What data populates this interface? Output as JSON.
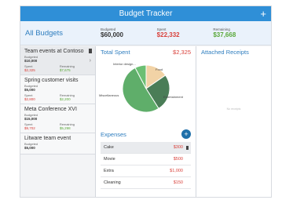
{
  "app": {
    "title": "Budget Tracker",
    "add_symbol": "+"
  },
  "summary": {
    "heading": "All Budgets",
    "budgeted": {
      "label": "Budgeted",
      "value": "$60,000"
    },
    "spent": {
      "label": "Spent",
      "value": "$22,332",
      "color": "#d9413b"
    },
    "remaining": {
      "label": "Remaining",
      "value": "$37,668",
      "color": "#5aa83a"
    }
  },
  "budgets": [
    {
      "name": "Team events at Contoso",
      "budgeted_label": "Budgeted",
      "budgeted": "$10,000",
      "spent_label": "Spent",
      "spent": "$2,325",
      "remaining_label": "Remaining",
      "remaining": "$7,675",
      "selected": true
    },
    {
      "name": "Spring customer visits",
      "budgeted_label": "Budgeted",
      "budgeted": "$5,000",
      "spent_label": "Spent",
      "spent": "$2,800",
      "remaining_label": "Remaining",
      "remaining": "$2,200"
    },
    {
      "name": "Meta Conference XVI",
      "budgeted_label": "Budgeted",
      "budgeted": "$15,000",
      "spent_label": "Spent",
      "spent": "$9,702",
      "remaining_label": "Remaining",
      "remaining": "$5,298"
    },
    {
      "name": "Litware team event",
      "budgeted_label": "Budgeted",
      "budgeted": "$5,000",
      "spent_label": "",
      "spent": "",
      "remaining_label": "",
      "remaining": ""
    }
  ],
  "total_spent": {
    "label": "Total Spent",
    "amount": "$2,325",
    "chart_data": {
      "type": "pie",
      "categories": [
        "Cake",
        "Movie",
        "Entertainment",
        "Miscellaneous"
      ],
      "labels_shown": [
        "Interior design...",
        "Food",
        "Entertainment",
        "Miscellaneous"
      ],
      "values": [
        300,
        500,
        1000,
        150
      ],
      "colors": [
        "#f2d3a6",
        "#4a7d57",
        "#5fae6a",
        "#6bbf73"
      ]
    }
  },
  "expenses": {
    "label": "Expenses",
    "add_symbol": "+",
    "items": [
      {
        "name": "Cake",
        "amount": "$300",
        "selected": true
      },
      {
        "name": "Movie",
        "amount": "$500"
      },
      {
        "name": "Extra",
        "amount": "$1,000"
      },
      {
        "name": "Cleaning",
        "amount": "$150"
      }
    ]
  },
  "receipts": {
    "label": "Attached Receipts",
    "empty_text": "No receipts"
  }
}
